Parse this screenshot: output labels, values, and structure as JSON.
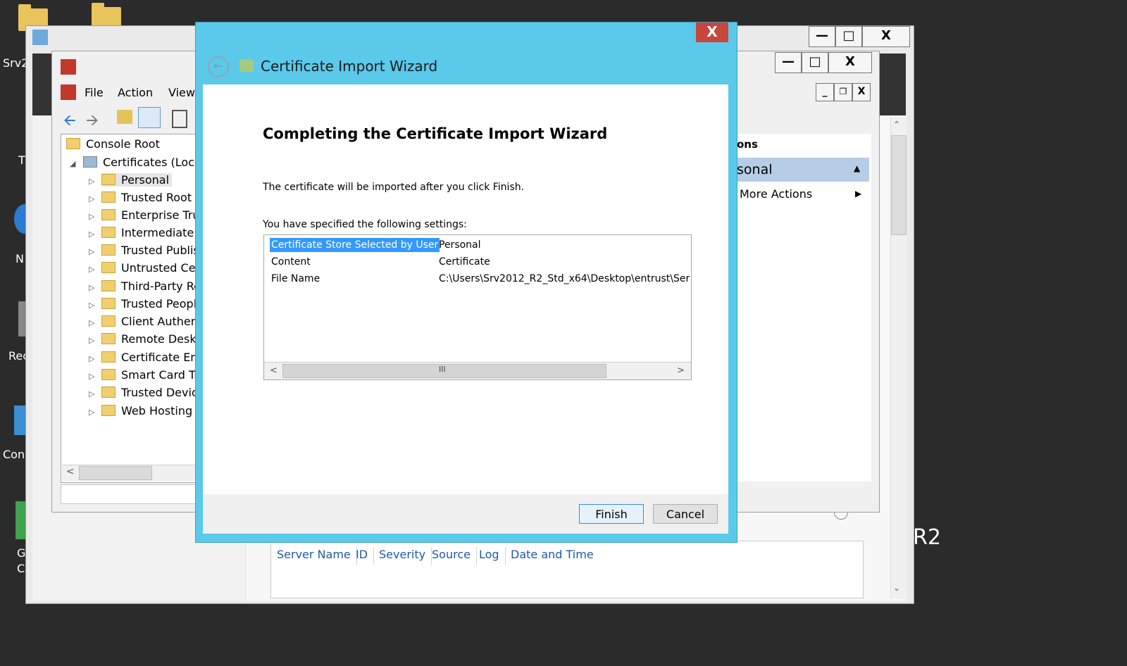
{
  "desktop": {
    "labels": [
      "Srv2",
      "T",
      "N",
      "Rec",
      "Con",
      "G",
      "Cl"
    ]
  },
  "server_manager": {
    "right_text": "R2",
    "event_columns": [
      "Server Name",
      "ID",
      "Severity",
      "Source",
      "Log",
      "Date and Time"
    ]
  },
  "mmc": {
    "menu": [
      "File",
      "Action",
      "View"
    ],
    "tree": {
      "root": "Console Root",
      "certificates": "Certificates (Local",
      "items": [
        "Personal",
        "Trusted Root C",
        "Enterprise Tru",
        "Intermediate C",
        "Trusted Publis",
        "Untrusted Cer",
        "Third-Party Ro",
        "Trusted Peopl",
        "Client Authen",
        "Remote Deskt",
        "Certificate Enr",
        "Smart Card Tr",
        "Trusted Devic",
        "Web Hosting"
      ]
    },
    "actions": {
      "header": "ons",
      "selected": "sonal",
      "more_actions": "More Actions"
    }
  },
  "wizard": {
    "title": "Certificate Import Wizard",
    "heading": "Completing the Certificate Import Wizard",
    "description": "The certificate will be imported after you click Finish.",
    "settings_label": "You have specified the following settings:",
    "settings": [
      {
        "name": "Certificate Store Selected by User",
        "value": "Personal"
      },
      {
        "name": "Content",
        "value": "Certificate"
      },
      {
        "name": "File Name",
        "value": "C:\\Users\\Srv2012_R2_Std_x64\\Desktop\\entrust\\Ser"
      }
    ],
    "close_glyph": "X",
    "finish_label": "Finish",
    "cancel_label": "Cancel"
  }
}
